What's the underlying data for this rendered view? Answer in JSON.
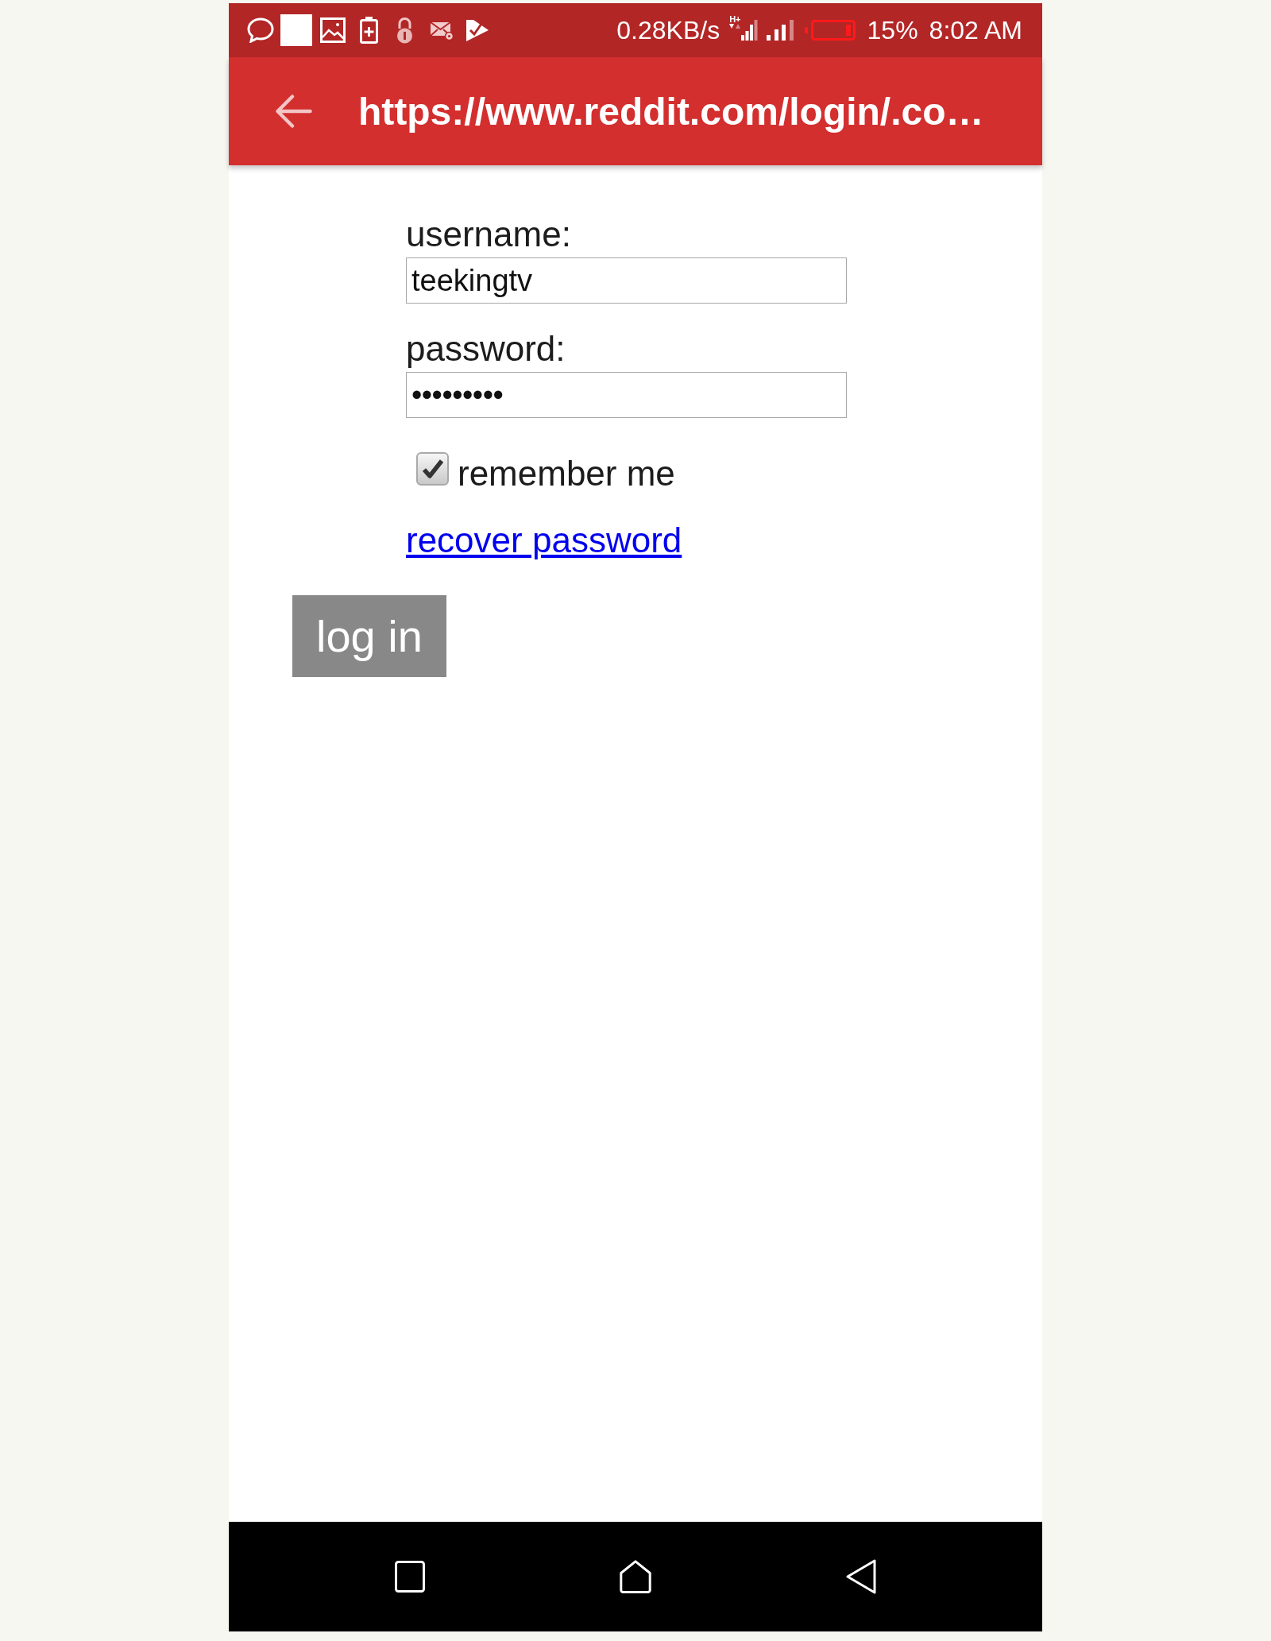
{
  "status_bar": {
    "network_speed": "0.28KB/s",
    "network_type": "H+",
    "battery_percent": "15%",
    "time": "8:02 AM"
  },
  "app_bar": {
    "title": "https://www.reddit.com/login/.co…"
  },
  "form": {
    "fields": [
      {
        "kind": "text",
        "label": "username:",
        "value": "teekingtv"
      },
      {
        "kind": "password",
        "label": "password:",
        "value": "•••••••••"
      }
    ],
    "remember": {
      "label": "remember me",
      "checked": true
    },
    "recover_link": {
      "label": "recover password"
    },
    "submit_button": {
      "label": "log in"
    }
  }
}
